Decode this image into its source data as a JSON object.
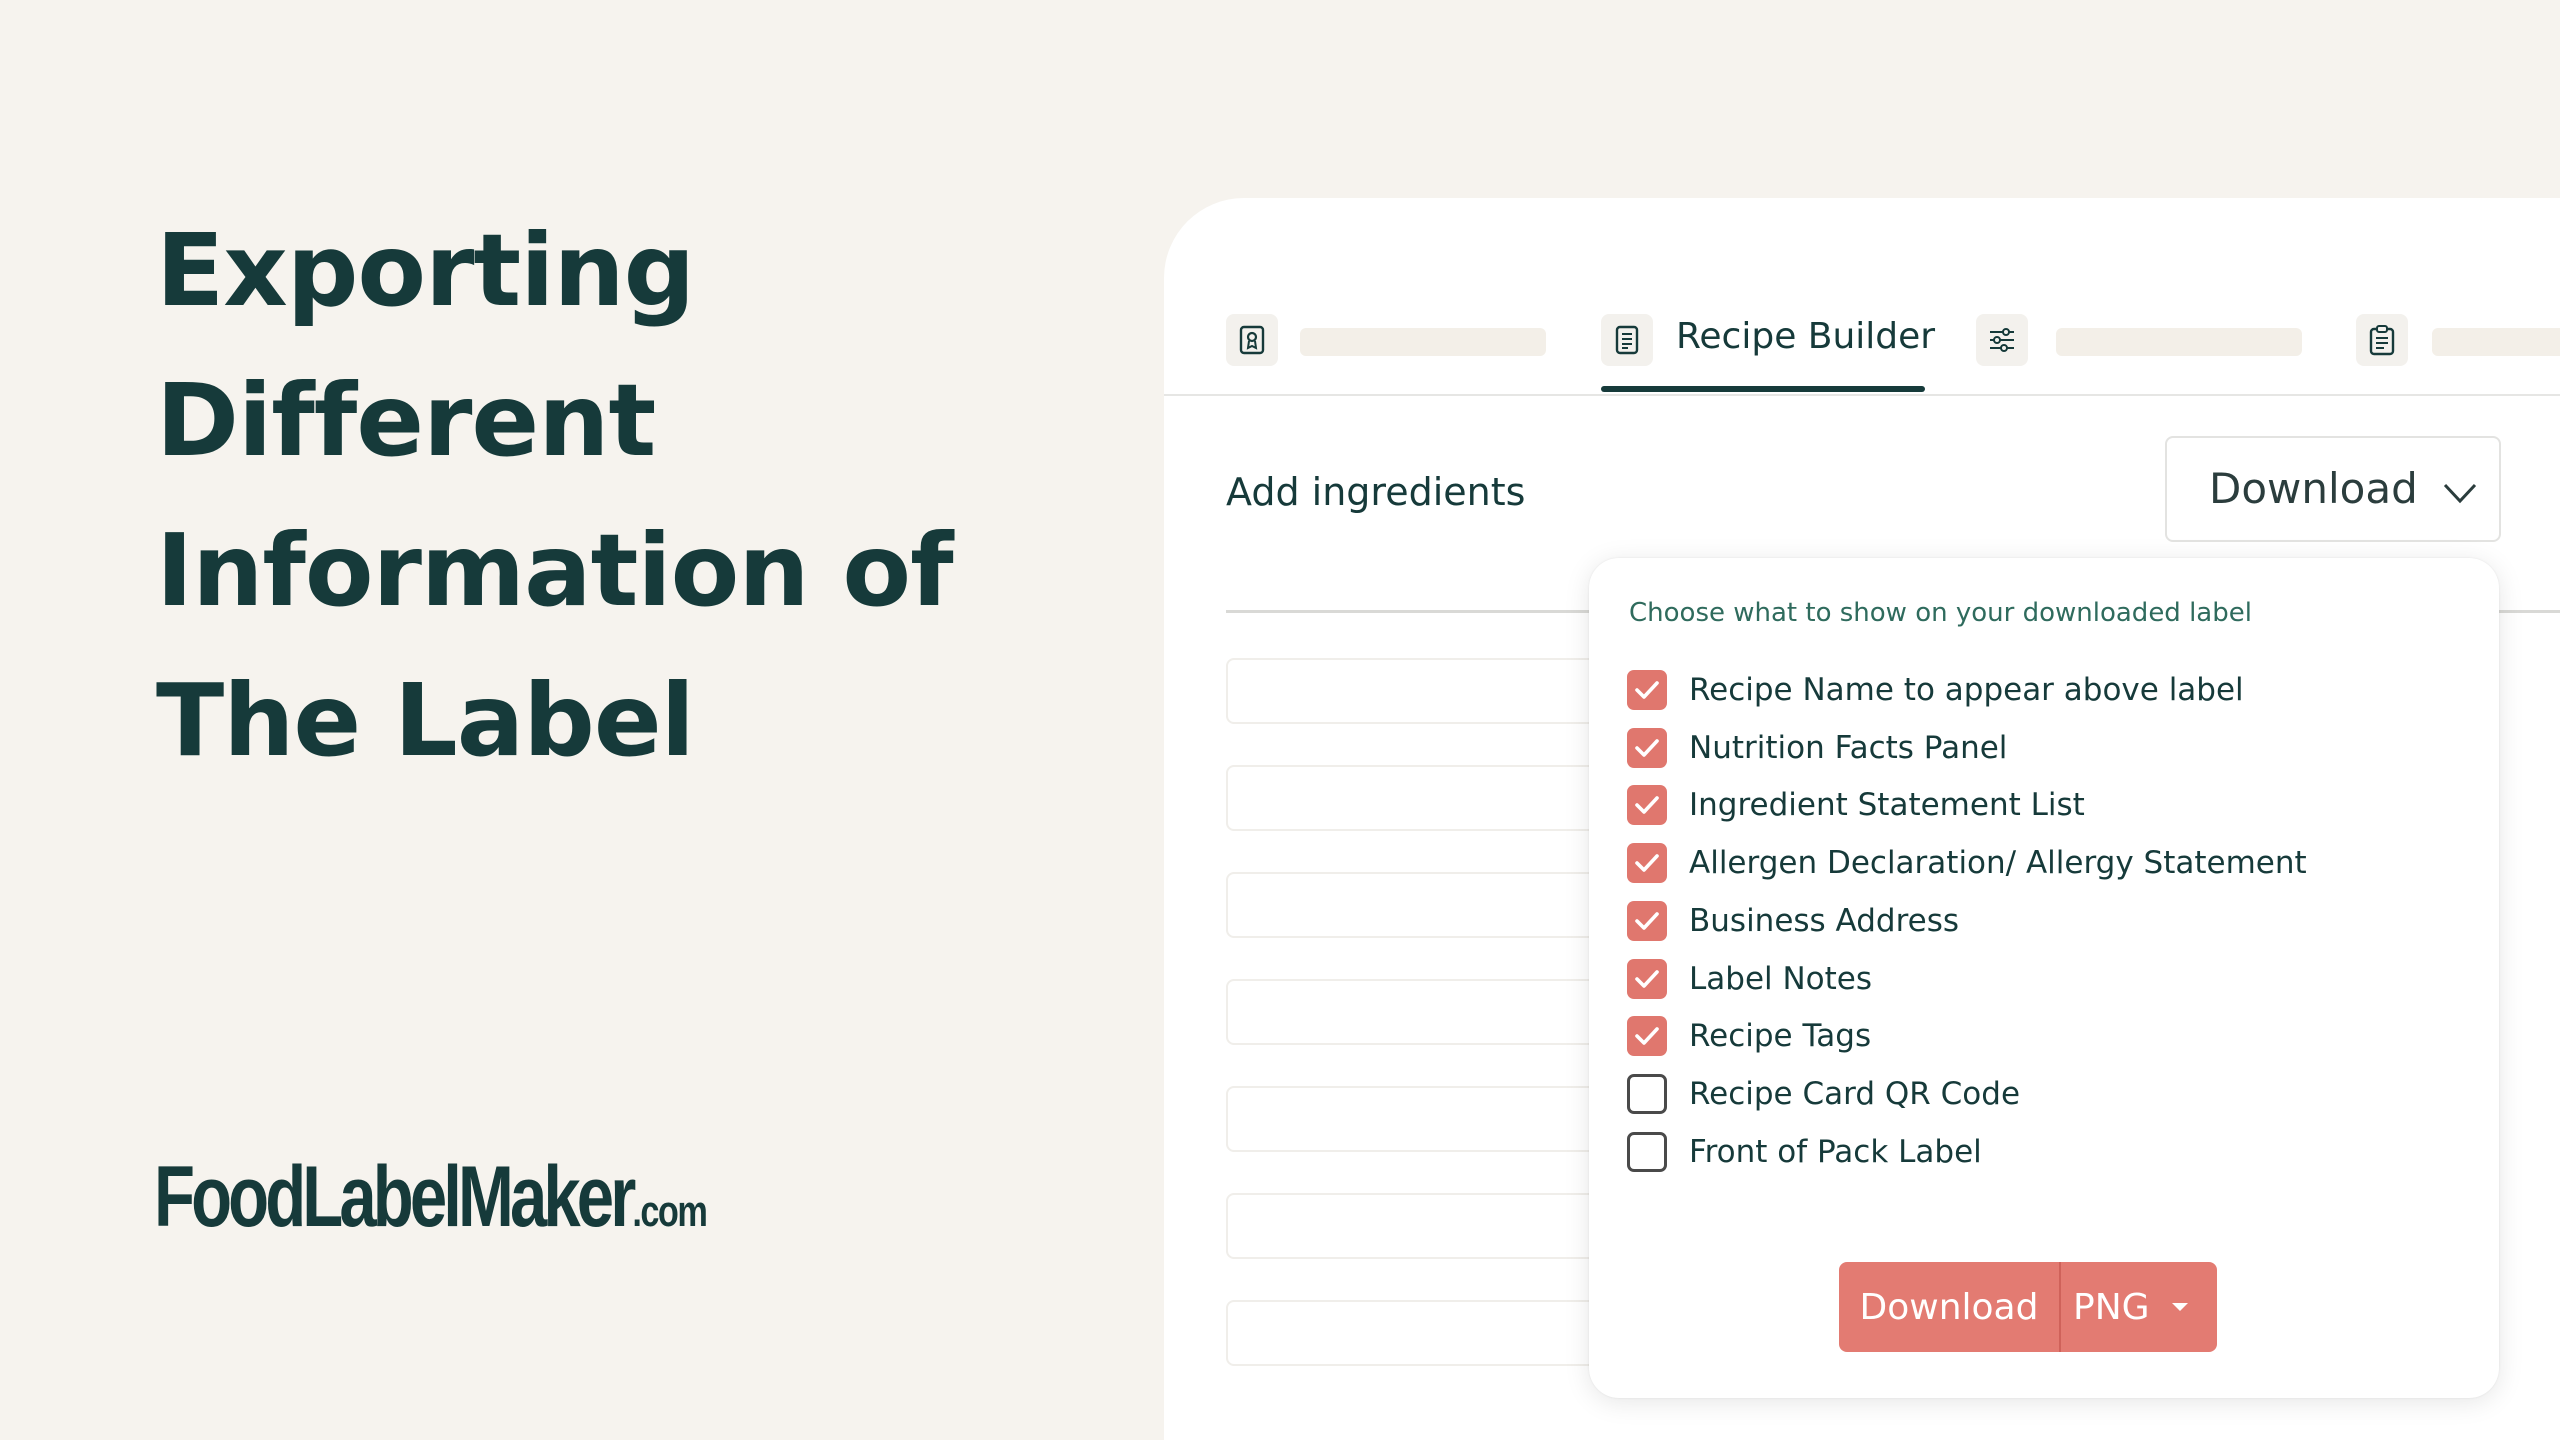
{
  "hero": {
    "title_lines": [
      "Exporting",
      "Different",
      "Information of",
      "The Label"
    ]
  },
  "brand": {
    "main": "FoodLabelMaker",
    "suffix": ".com"
  },
  "app": {
    "tabs": [
      {
        "icon": "badge-icon",
        "label": ""
      },
      {
        "icon": "document-icon",
        "label": "Recipe Builder",
        "active": true
      },
      {
        "icon": "sliders-icon",
        "label": ""
      },
      {
        "icon": "clipboard-icon",
        "label": ""
      }
    ],
    "section_title": "Add ingredients",
    "download_select": {
      "label": "Download"
    },
    "options": {
      "heading": "Choose what to show on your downloaded label",
      "items": [
        {
          "label": "Recipe Name to appear above label",
          "checked": true
        },
        {
          "label": "Nutrition Facts Panel",
          "checked": true
        },
        {
          "label": "Ingredient Statement List",
          "checked": true
        },
        {
          "label": "Allergen Declaration/ Allergy Statement",
          "checked": true
        },
        {
          "label": "Business Address",
          "checked": true
        },
        {
          "label": "Label Notes",
          "checked": true
        },
        {
          "label": "Recipe Tags",
          "checked": true
        },
        {
          "label": "Recipe Card QR Code",
          "checked": false
        },
        {
          "label": "Front of Pack Label",
          "checked": false
        }
      ],
      "download_button": {
        "label": "Download",
        "format": "PNG"
      }
    }
  },
  "colors": {
    "background": "#f6f3ee",
    "text_dark": "#163a3a",
    "accent": "#e37b72",
    "checkbox_checked": "#e0776e"
  }
}
